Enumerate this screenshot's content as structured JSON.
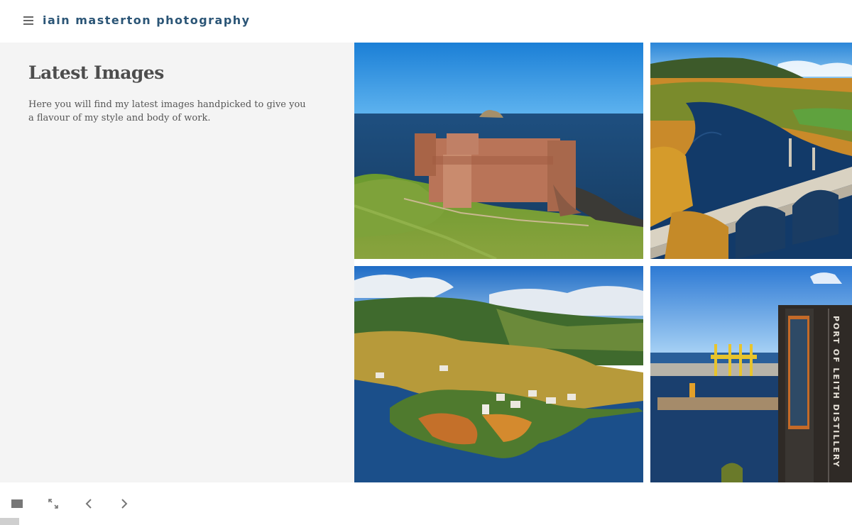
{
  "header": {
    "site_title": "iain masterton photography",
    "menu_icon": "hamburger-menu-icon"
  },
  "main": {
    "title": "Latest Images",
    "intro": "Here you will find my latest images handpicked to give you a flavour of my style and body of work."
  },
  "gallery": {
    "images": [
      {
        "subject": "coastal castle ruin aerial"
      },
      {
        "subject": "river bridge autumn aerial"
      },
      {
        "subject": "lochside village autumn aerial"
      },
      {
        "subject": "distillery tower harbour"
      }
    ],
    "distillery_sign": "PORT OF LEITH DISTILLERY"
  },
  "controls": {
    "icons": [
      "stop-icon",
      "fullscreen-icon",
      "chevron-left-icon",
      "chevron-right-icon"
    ]
  },
  "colors": {
    "title_blue": "#2b5576",
    "panel_bg": "#f4f4f4",
    "heading_text": "#4d4d4d"
  }
}
